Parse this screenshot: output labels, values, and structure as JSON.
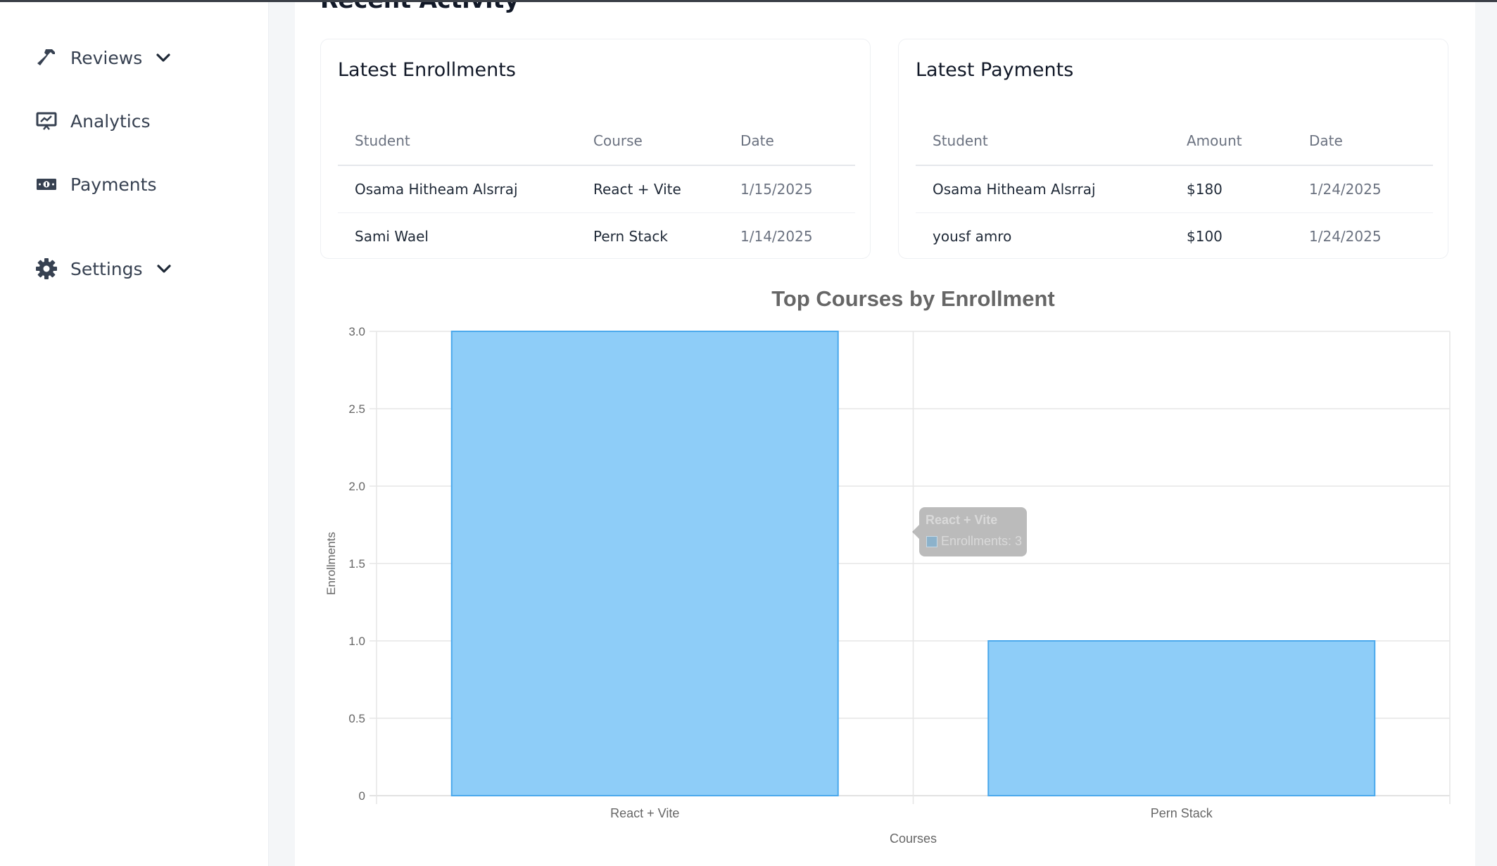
{
  "sidebar": {
    "items": [
      {
        "label": "Reviews",
        "icon": "hammer-icon",
        "has_dropdown": true
      },
      {
        "label": "Analytics",
        "icon": "presentation-chart-icon",
        "has_dropdown": false
      },
      {
        "label": "Payments",
        "icon": "money-bill-icon",
        "has_dropdown": false
      },
      {
        "label": "Settings",
        "icon": "gear-icon",
        "has_dropdown": true
      }
    ]
  },
  "section": {
    "title": "Recent Activity"
  },
  "enrollments": {
    "title": "Latest Enrollments",
    "columns": [
      "Student",
      "Course",
      "Date"
    ],
    "rows": [
      [
        "Osama Hitheam Alsrraj",
        "React + Vite",
        "1/15/2025"
      ],
      [
        "Sami Wael",
        "Pern Stack",
        "1/14/2025"
      ]
    ]
  },
  "payments": {
    "title": "Latest Payments",
    "columns": [
      "Student",
      "Amount",
      "Date"
    ],
    "rows": [
      [
        "Osama Hitheam Alsrraj",
        "$180",
        "1/24/2025"
      ],
      [
        "yousf amro",
        "$100",
        "1/24/2025"
      ]
    ]
  },
  "chart_data": {
    "type": "bar",
    "title": "Top Courses by Enrollment",
    "xlabel": "Courses",
    "ylabel": "Enrollments",
    "categories": [
      "React + Vite",
      "Pern Stack"
    ],
    "series": [
      {
        "name": "Enrollments",
        "values": [
          3,
          1
        ]
      }
    ],
    "ylim": [
      0,
      3
    ],
    "yticks": [
      "0",
      "0.5",
      "1.0",
      "1.5",
      "2.0",
      "2.5",
      "3.0"
    ],
    "grid": true,
    "bar_color": "#8ecdf8",
    "bar_border": "#4aa8ec",
    "tooltip": {
      "title": "React + Vite",
      "text": "Enrollments: 3"
    }
  }
}
